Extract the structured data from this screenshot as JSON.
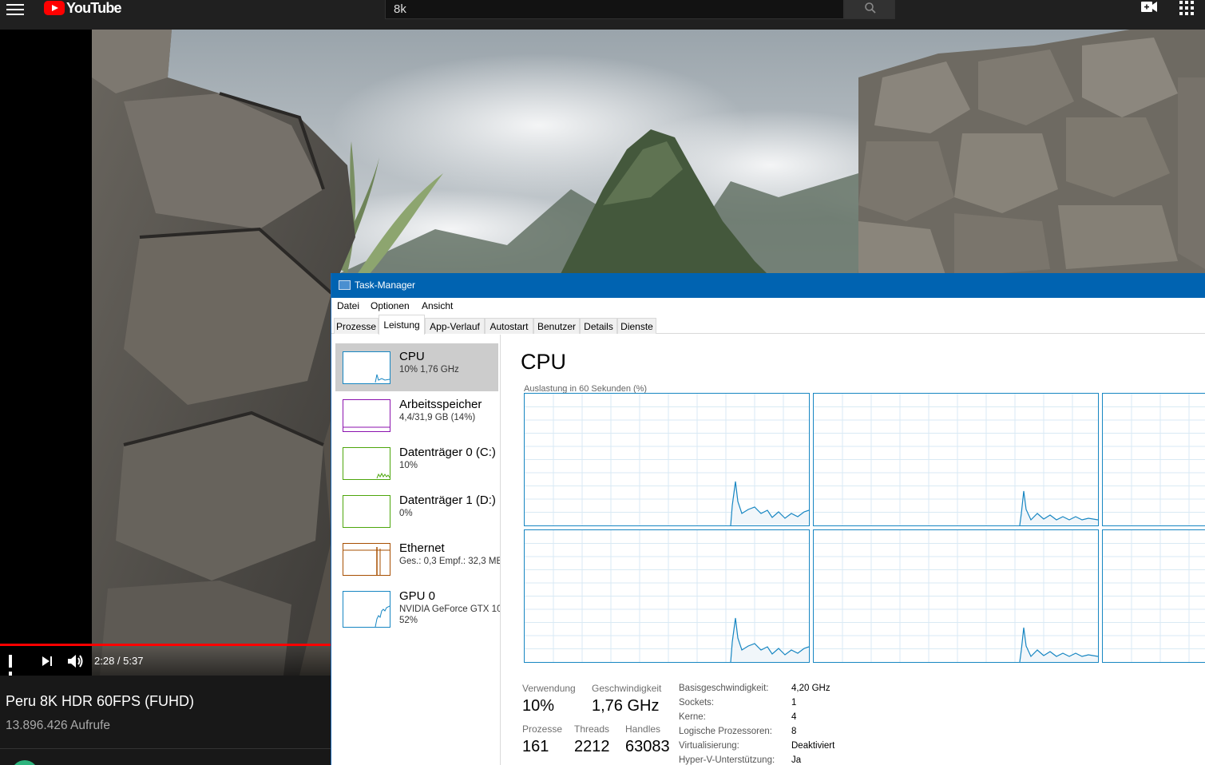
{
  "youtube": {
    "logo_text": "YouTube",
    "search_value": "8k",
    "video": {
      "time": "2:28 / 5:37",
      "progress": 0.44,
      "title": "Peru 8K HDR 60FPS (FUHD)",
      "views": "13.896.426 Aufrufe"
    }
  },
  "task_manager": {
    "title": "Task-Manager",
    "menu": [
      "Datei",
      "Optionen",
      "Ansicht"
    ],
    "tabs": [
      "Prozesse",
      "Leistung",
      "App-Verlauf",
      "Autostart",
      "Benutzer",
      "Details",
      "Dienste"
    ],
    "active_tab": "Leistung",
    "sidebar": [
      {
        "name": "CPU",
        "sub": "10% 1,76 GHz",
        "color": "#1786c2"
      },
      {
        "name": "Arbeitsspeicher",
        "sub": "4,4/31,9 GB (14%)",
        "color": "#8b12ae"
      },
      {
        "name": "Datenträger 0 (C:)",
        "sub": "10%",
        "color": "#4da60c"
      },
      {
        "name": "Datenträger 1 (D:)",
        "sub": "0%",
        "color": "#4da60c"
      },
      {
        "name": "Ethernet",
        "sub": "Ges.: 0,3  Empf.: 32,3 MB",
        "color": "#a74f01"
      },
      {
        "name": "GPU 0",
        "sub": "NVIDIA GeForce GTX 10",
        "sub2": "52%",
        "color": "#1786c2"
      }
    ],
    "main": {
      "heading": "CPU",
      "graph_label": "Auslastung in 60 Sekunden (%)",
      "stats": {
        "usage_label": "Verwendung",
        "usage_value": "10%",
        "speed_label": "Geschwindigkeit",
        "speed_value": "1,76 GHz",
        "processes_label": "Prozesse",
        "processes_value": "161",
        "threads_label": "Threads",
        "threads_value": "2212",
        "handles_label": "Handles",
        "handles_value": "63083"
      },
      "details": [
        {
          "k": "Basisgeschwindigkeit:",
          "v": "4,20 GHz"
        },
        {
          "k": "Sockets:",
          "v": "1"
        },
        {
          "k": "Kerne:",
          "v": "4"
        },
        {
          "k": "Logische Prozessoren:",
          "v": "8"
        },
        {
          "k": "Virtualisierung:",
          "v": "Deaktiviert"
        },
        {
          "k": "Hyper-V-Unterstützung:",
          "v": "Ja"
        }
      ]
    }
  },
  "colors": {
    "yt_red": "#ff0000",
    "tm_titlebar": "#0063b1",
    "cpu_graph": "#1786c2"
  }
}
